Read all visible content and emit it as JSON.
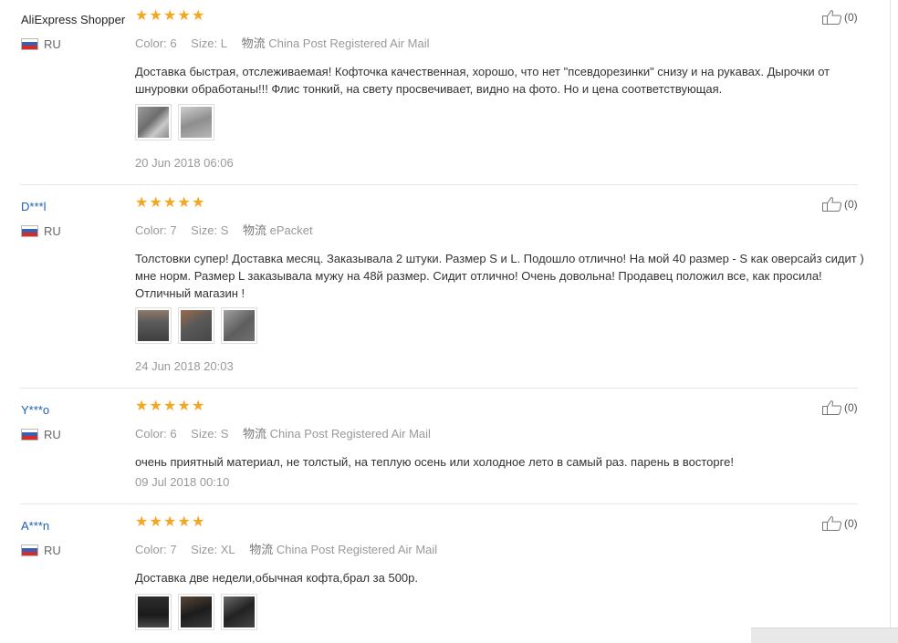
{
  "reviews": [
    {
      "user": "AliExpress Shopper",
      "country": "RU",
      "stars": 5,
      "color_label": "Color:",
      "color_value": "6",
      "size_label": "Size:",
      "size_value": "L",
      "ship_label": "物流",
      "ship_value": "China Post Registered Air Mail",
      "text": "Доставка быстрая, отслеживаемая! Кофточка качественная, хорошо, что нет \"псевдорезинки\" снизу и на рукавах. Дырочки от шнуровки обработаны!!! Флис тонкий, на свету просвечивает, видно на фото. Но и цена соответствующая.",
      "photos": 2,
      "date": "20 Jun 2018 06:06",
      "helpful": "(0)"
    },
    {
      "user": "D***l",
      "country": "RU",
      "stars": 5,
      "color_label": "Color:",
      "color_value": "7",
      "size_label": "Size:",
      "size_value": "S",
      "ship_label": "物流",
      "ship_value": "ePacket",
      "text": "Толстовки супер! Доставка месяц. Заказывала 2 штуки. Размер S и L. Подошло отлично! На мой 40 размер - S как оверсайз сидит ) мне норм. Размер L заказывала мужу на 48й размер. Сидит отлично! Очень довольна! Продавец положил все, как просила! Отличный магазин !",
      "photos": 3,
      "date": "24 Jun 2018 20:03",
      "helpful": "(0)"
    },
    {
      "user": "Y***o",
      "country": "RU",
      "stars": 5,
      "color_label": "Color:",
      "color_value": "6",
      "size_label": "Size:",
      "size_value": "S",
      "ship_label": "物流",
      "ship_value": "China Post Registered Air Mail",
      "text": "очень приятный материал, не толстый, на теплую осень или холодное лето в самый раз. парень в восторге!",
      "photos": 0,
      "date": "09 Jul 2018 00:10",
      "helpful": "(0)"
    },
    {
      "user": "A***n",
      "country": "RU",
      "stars": 5,
      "color_label": "Color:",
      "color_value": "7",
      "size_label": "Size:",
      "size_value": "XL",
      "ship_label": "物流",
      "ship_value": "China Post Registered Air Mail",
      "text": "Доставка две недели,обычная кофта,брал за 500р.",
      "photos": 3,
      "date": "",
      "helpful": "(0)"
    }
  ],
  "colors": {
    "star": "#f5a623",
    "user_link": "#1c5fb3",
    "meta_gray": "#999999"
  },
  "icons": {
    "star": "star-icon",
    "flag": "russia-flag-icon",
    "helpful": "thumbs-up-icon"
  }
}
